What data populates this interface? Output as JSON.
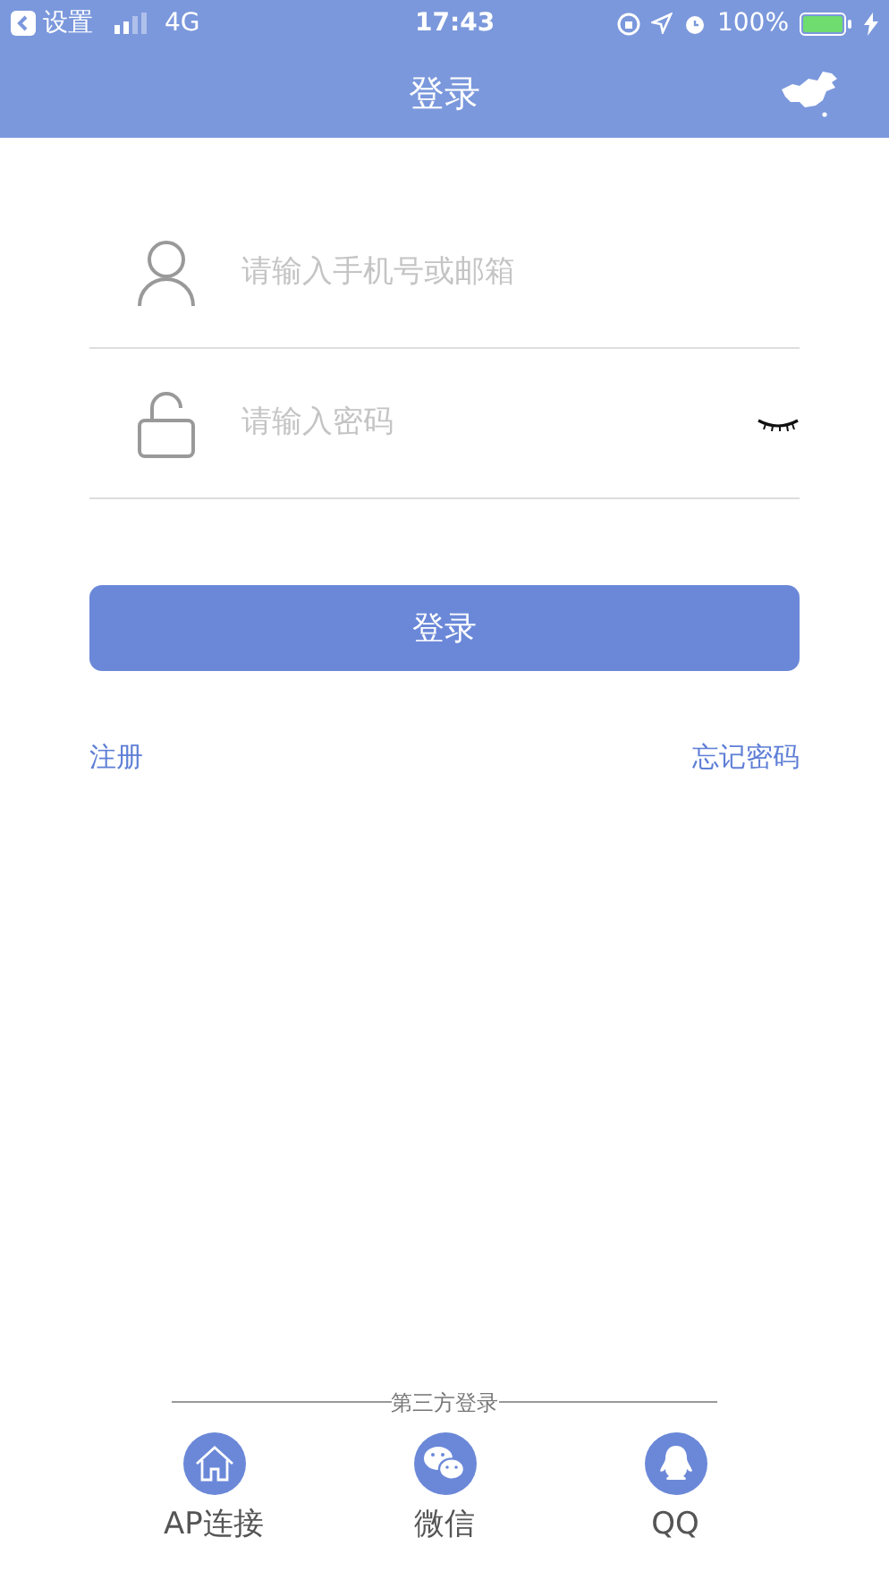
{
  "status_bar": {
    "back_label": "设置",
    "network": "4G",
    "time": "17:43",
    "battery": "100%"
  },
  "nav": {
    "title": "登录"
  },
  "fields": [
    {
      "kind": "account",
      "placeholder": "请输入手机号或邮箱"
    },
    {
      "kind": "password",
      "placeholder": "请输入密码"
    }
  ],
  "login_button": "登录",
  "register_link": "注册",
  "forgot_link": "忘记密码",
  "third_party": {
    "label": "第三方登录",
    "items": [
      {
        "kind": "ap",
        "label": "AP连接"
      },
      {
        "kind": "wechat",
        "label": "微信"
      },
      {
        "kind": "qq",
        "label": "QQ"
      }
    ]
  }
}
